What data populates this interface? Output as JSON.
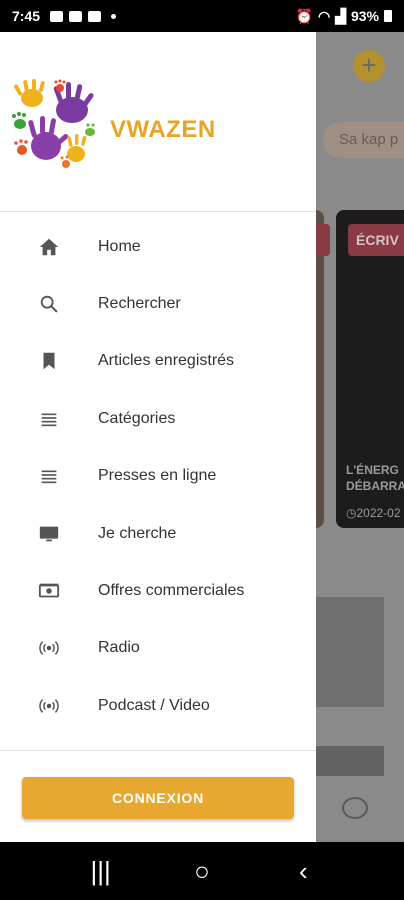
{
  "status": {
    "time": "7:45",
    "battery": "93%"
  },
  "background": {
    "chip_text": "Sa kap p",
    "card_tag": "ÉCRIV",
    "card_title_line1": "L'ÉNERG",
    "card_title_line2": "DÉBARRA",
    "card_date": "2022-02",
    "add_button": "+"
  },
  "drawer": {
    "brand": "VWAZEN",
    "menu": [
      {
        "label": "Home",
        "icon": "home-icon"
      },
      {
        "label": "Rechercher",
        "icon": "search-icon"
      },
      {
        "label": "Articles enregistrés",
        "icon": "bookmark-icon"
      },
      {
        "label": "Catégories",
        "icon": "list-icon"
      },
      {
        "label": "Presses en ligne",
        "icon": "list-icon"
      },
      {
        "label": "Je cherche",
        "icon": "monitor-icon"
      },
      {
        "label": "Offres commerciales",
        "icon": "money-icon"
      },
      {
        "label": "Radio",
        "icon": "radio-icon"
      },
      {
        "label": "Podcast / Video",
        "icon": "radio-icon"
      }
    ],
    "connexion_label": "CONNEXION"
  },
  "nav": {
    "recents": "|||",
    "home": "○",
    "back": "‹"
  },
  "colors": {
    "brand": "#e8a424",
    "button": "#e8a830"
  }
}
